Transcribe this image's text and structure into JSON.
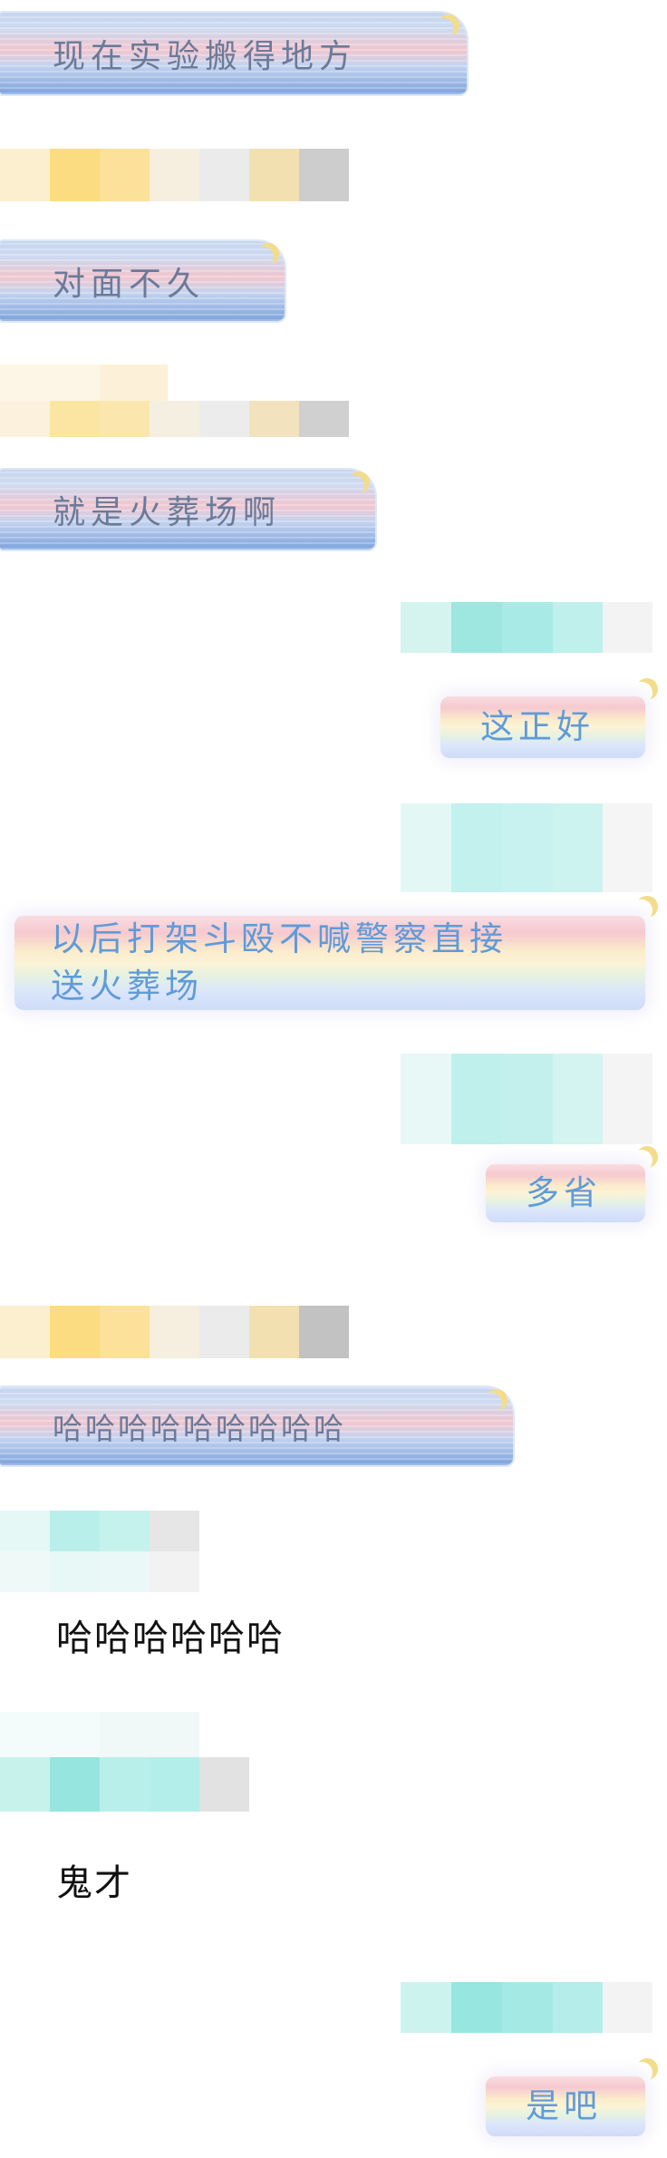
{
  "messages": {
    "m1": "现在实验搬得地方",
    "m2": "对面不久",
    "m3": "就是火葬场啊",
    "m4": "这正好",
    "m5_line1": "以后打架斗殴不喊警察直接",
    "m5_line2": "送火葬场",
    "m6": "多省",
    "m7": "哈哈哈哈哈哈哈哈哈",
    "m8": "哈哈哈哈哈哈",
    "m9": "鬼才",
    "m10": "是吧"
  },
  "colors": {
    "left_bubble_text": "#6b7a99",
    "right_bubble_text": "#5f9bd8",
    "plain_text": "#111111",
    "background": "#ffffff"
  }
}
